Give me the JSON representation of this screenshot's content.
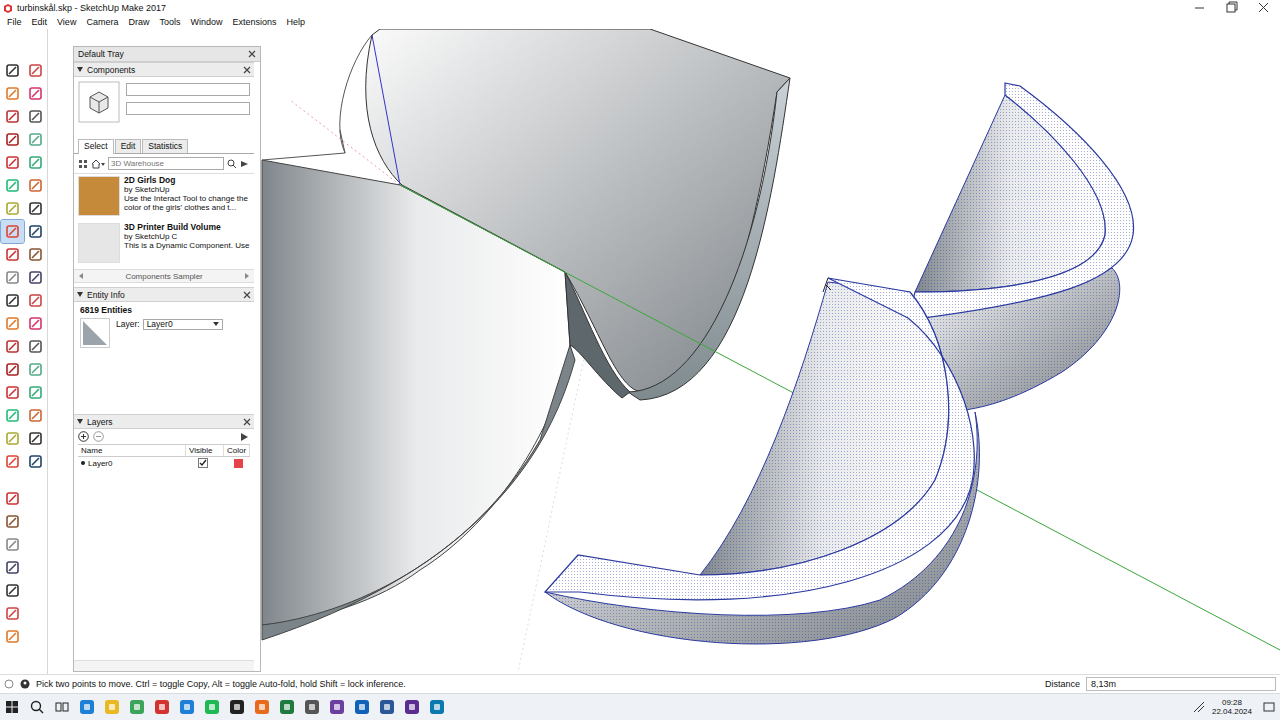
{
  "window": {
    "title": "turbinskål.skp - SketchUp Make 2017"
  },
  "menu": [
    "File",
    "Edit",
    "View",
    "Camera",
    "Draw",
    "Tools",
    "Window",
    "Extensions",
    "Help"
  ],
  "toolbar": {
    "tools": [
      {
        "selected": false
      },
      {
        "selected": false
      },
      {
        "selected": false
      },
      {
        "selected": false
      },
      {
        "selected": false
      },
      {
        "selected": false
      },
      {
        "selected": false
      },
      {
        "selected": false
      },
      {
        "selected": false
      },
      {
        "selected": false
      },
      {
        "selected": false
      },
      {
        "selected": false
      },
      {
        "selected": false
      },
      {
        "selected": false
      },
      {
        "selected": true
      },
      {
        "selected": false
      },
      {
        "selected": false
      },
      {
        "selected": false
      },
      {
        "selected": false
      },
      {
        "selected": false
      },
      {
        "selected": false
      },
      {
        "selected": false
      },
      {
        "selected": false
      },
      {
        "selected": false
      },
      {
        "selected": false
      },
      {
        "selected": false
      },
      {
        "selected": false
      },
      {
        "selected": false
      },
      {
        "selected": false
      },
      {
        "selected": false
      },
      {
        "selected": false
      },
      {
        "selected": false
      },
      {
        "selected": false
      },
      {
        "selected": false
      },
      {
        "selected": false
      },
      {
        "selected": false
      },
      {
        "selected": false
      },
      {
        "selected": false
      },
      {
        "selected": false
      },
      {
        "selected": false
      },
      {
        "selected": false
      },
      {
        "selected": false
      },
      {
        "selected": false
      }
    ]
  },
  "tray": {
    "title": "Default Tray",
    "components": {
      "title": "Components",
      "tabs": [
        {
          "label": "Select",
          "selected": true
        },
        {
          "label": "Edit",
          "selected": false
        },
        {
          "label": "Statistics",
          "selected": false
        }
      ],
      "search": {
        "placeholder": "3D Warehouse"
      },
      "items": [
        {
          "name": "2D Girls Dog",
          "author": "by SketchUp",
          "description": "Use the Interact Tool to change the color of the girls' clothes and t..."
        },
        {
          "name": "3D Printer Build Volume",
          "author": "by SketchUp C",
          "description": "This is a Dynamic Component. Use"
        }
      ],
      "footer": "Components Sampler"
    },
    "entity_info": {
      "title": "Entity Info",
      "count": "6819 Entities",
      "layer_label": "Layer:",
      "layer_value": "Layer0"
    },
    "layers": {
      "title": "Layers",
      "columns": [
        "Name",
        "Visible",
        "Color"
      ],
      "rows": [
        {
          "name": "Layer0",
          "current": true,
          "visible": true,
          "color": "#e8434a"
        }
      ]
    }
  },
  "status_bar": {
    "hint": "Pick two points to move. Ctrl = toggle Copy, Alt = toggle Auto-fold, hold Shift = lock inference.",
    "measure_label": "Distance",
    "measure_value": "8,13m"
  },
  "taskbar": {
    "time": "09:28",
    "date": "22.04.2024"
  }
}
